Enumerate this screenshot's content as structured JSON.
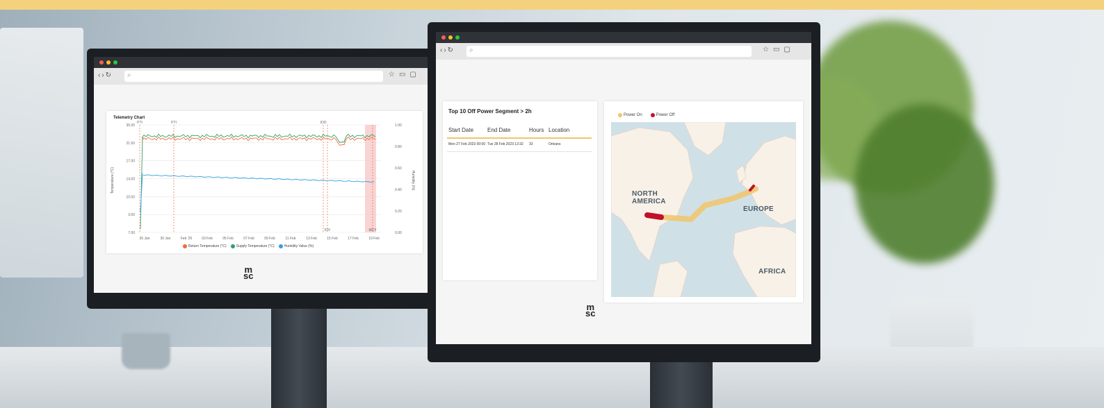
{
  "colors": {
    "accent_strip": "#f4d27d",
    "return_temp": "#f26b3a",
    "supply_temp": "#2e9e6b",
    "humidity": "#2f9fe0",
    "power_on": "#f2c46a",
    "power_off": "#c0102a"
  },
  "left_monitor": {
    "url_icon": "search-icon",
    "chart": {
      "title": "Telemetry Chart",
      "y_left_label": "Temperature (°C)",
      "y_right_label": "Humidity (%)",
      "y_left_ticks": [
        "35.00",
        "21.50",
        "17.00",
        "14.00",
        "10.00",
        "3.00",
        "7.00"
      ],
      "y_right_ticks": [
        "1.00",
        "0.80",
        "0.60",
        "0.40",
        "0.20",
        "0.00"
      ],
      "x_ticks": [
        "26 Jan",
        "30 Jan",
        "Feb '25",
        "03 Feb",
        "05 Feb",
        "07 Feb",
        "09 Feb",
        "11 Feb",
        "13 Feb",
        "15 Feb",
        "17 Feb",
        "19 Feb"
      ],
      "event_labels": [
        "PTI",
        "PTI",
        "IOD",
        "IOV",
        "MCY"
      ],
      "legend": [
        "Return Temperature (°C)",
        "Supply Temperature (°C)",
        "Humidity Value (%)"
      ]
    },
    "logo_top": "m",
    "logo_bottom": "sc"
  },
  "right_monitor": {
    "url_icon": "search-icon",
    "table": {
      "title": "Top 10 Off Power Segment > 2h",
      "headers": [
        "Start Date",
        "End Date",
        "Hours",
        "Location"
      ],
      "rows": [
        [
          "Mon 27 Feb 2023 00:00",
          "Tue 28 Feb 2023 13:32",
          "33",
          "Orleans"
        ]
      ]
    },
    "map": {
      "legend": [
        "Power On",
        "Power Off"
      ],
      "labels": {
        "north_america_1": "NORTH",
        "north_america_2": "AMERICA",
        "europe": "EUROPE",
        "africa": "AFRICA"
      }
    },
    "logo_top": "m",
    "logo_bottom": "sc"
  }
}
